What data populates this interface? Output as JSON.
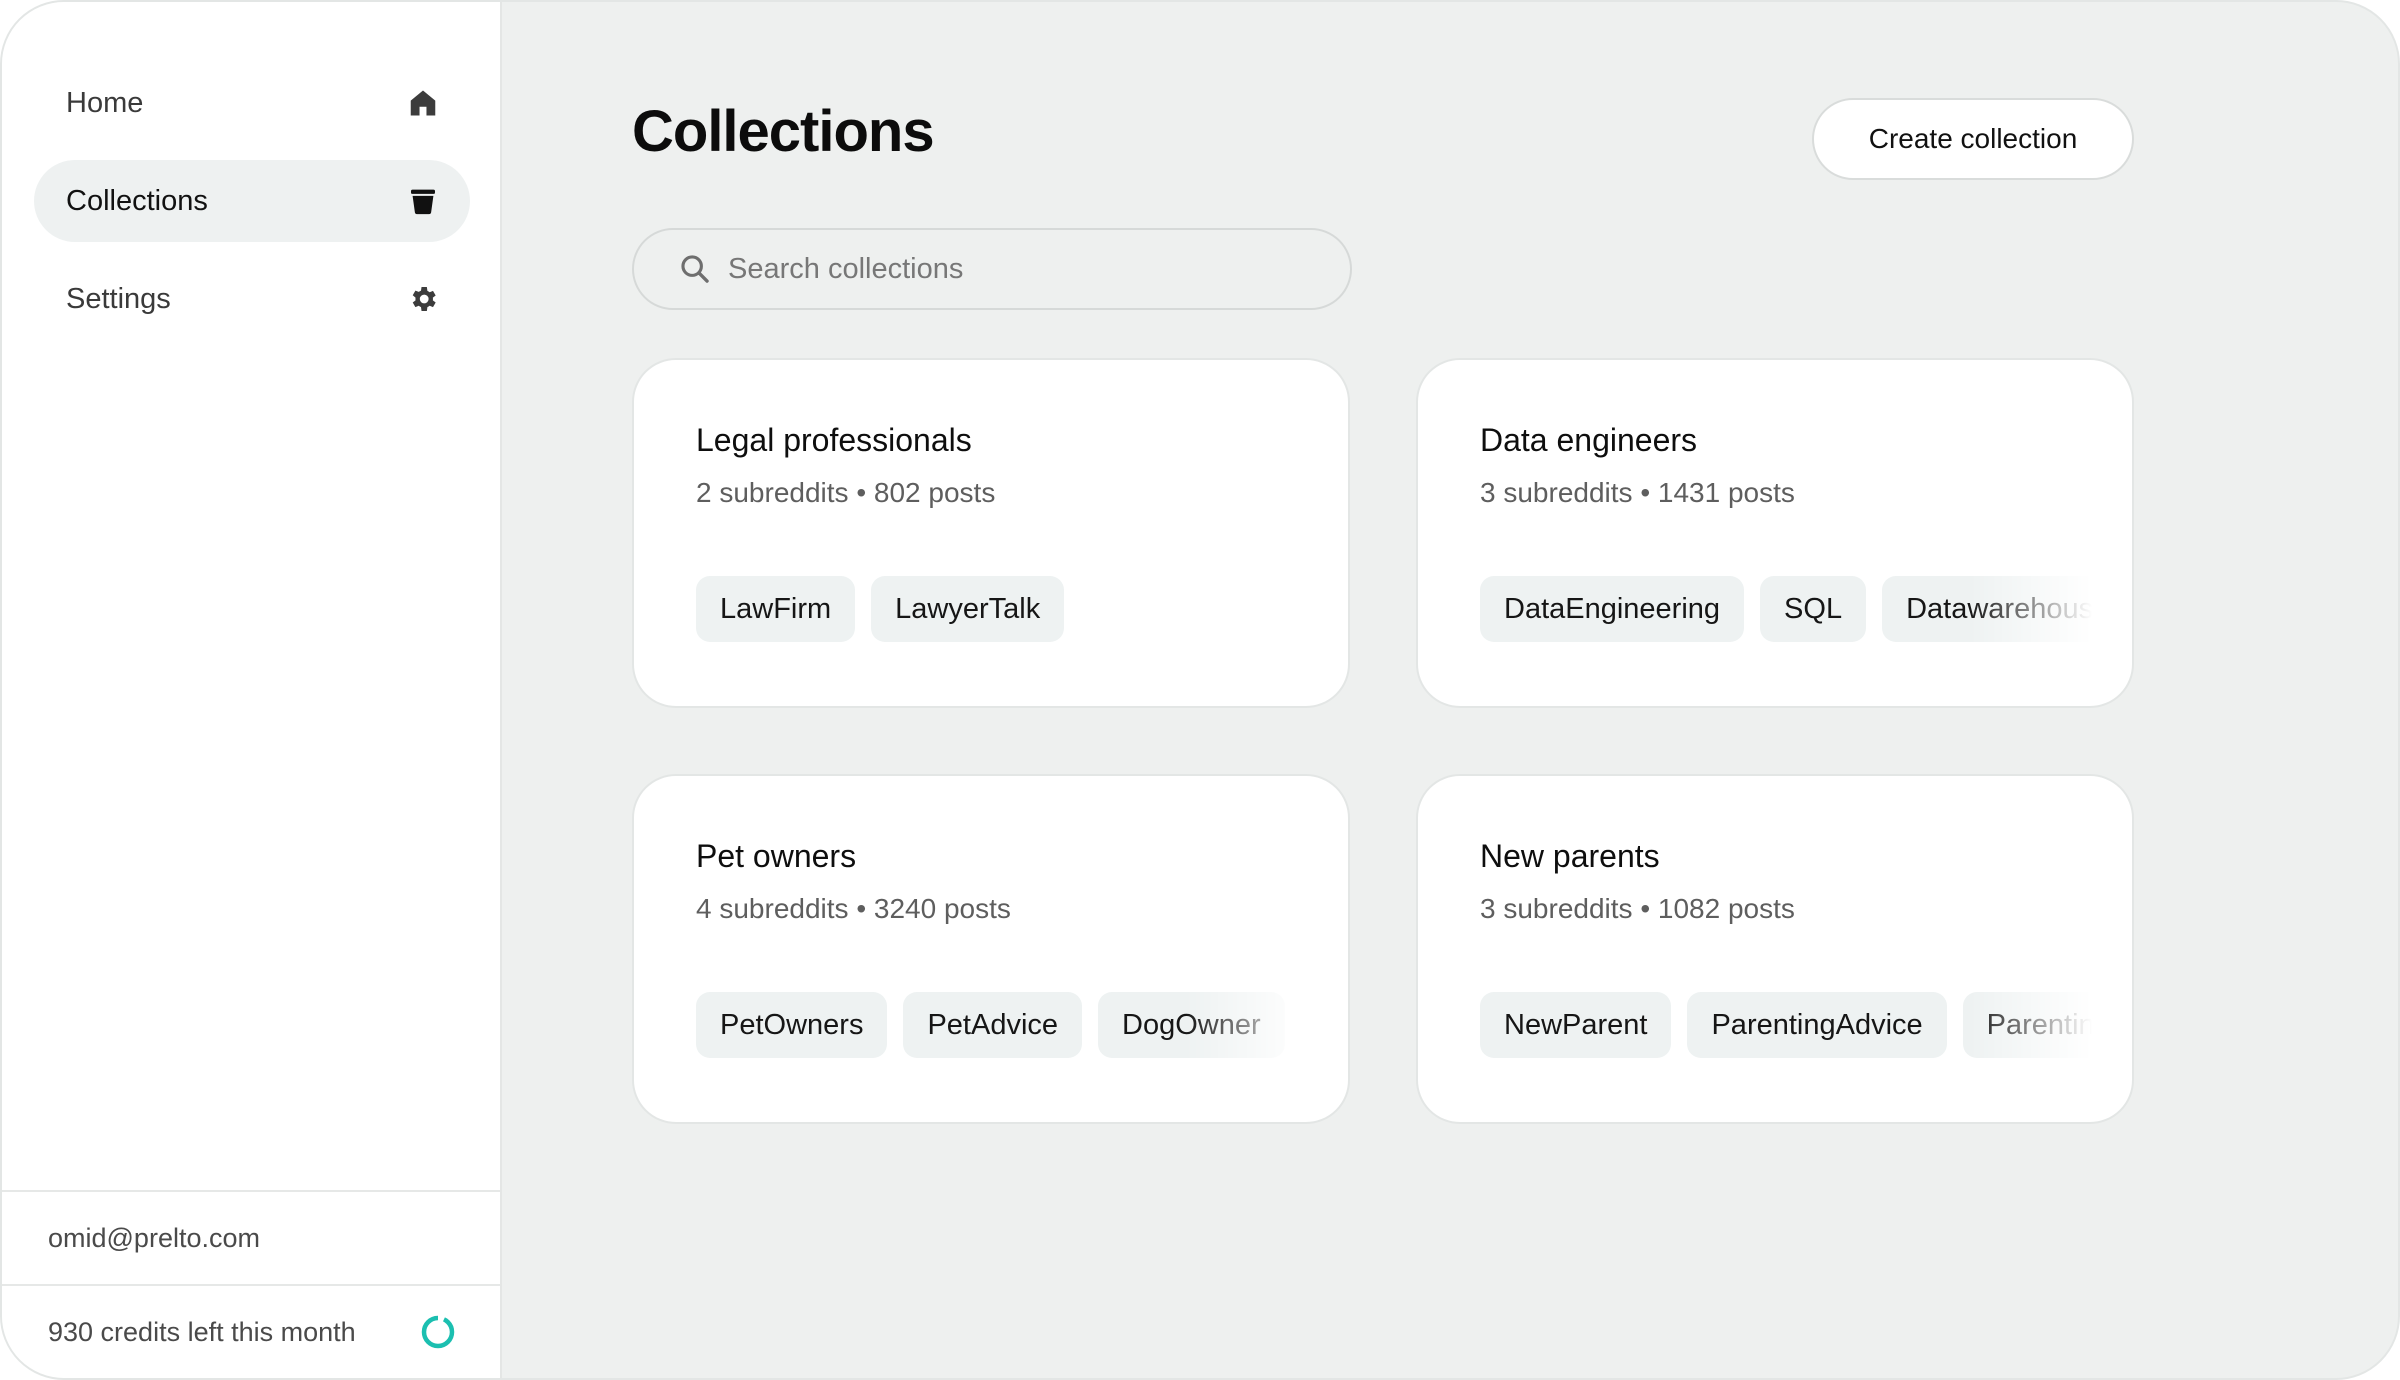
{
  "sidebar": {
    "items": [
      {
        "label": "Home",
        "icon": "home-icon",
        "active": false
      },
      {
        "label": "Collections",
        "icon": "bucket-icon",
        "active": true
      },
      {
        "label": "Settings",
        "icon": "gear-icon",
        "active": false
      }
    ],
    "user_email": "omid@prelto.com",
    "credits_text": "930 credits left this month",
    "credits_fraction_used": 0.07
  },
  "main": {
    "title": "Collections",
    "create_label": "Create collection",
    "search_placeholder": "Search collections",
    "cards": [
      {
        "title": "Legal professionals",
        "meta": "2 subreddits • 802 posts",
        "tags": [
          "LawFirm",
          "LawyerTalk"
        ]
      },
      {
        "title": "Data engineers",
        "meta": "3 subreddits • 1431 posts",
        "tags": [
          "DataEngineering",
          "SQL",
          "Datawarehouse"
        ]
      },
      {
        "title": "Pet owners",
        "meta": "4 subreddits • 3240 posts",
        "tags": [
          "PetOwners",
          "PetAdvice",
          "DogOwner"
        ]
      },
      {
        "title": "New parents",
        "meta": "3 subreddits • 1082 posts",
        "tags": [
          "NewParent",
          "ParentingAdvice",
          "Parenting"
        ]
      }
    ]
  },
  "colors": {
    "accent": "#1bbfb0",
    "background": "#eef0ef",
    "tag_bg": "#eef2f2"
  }
}
